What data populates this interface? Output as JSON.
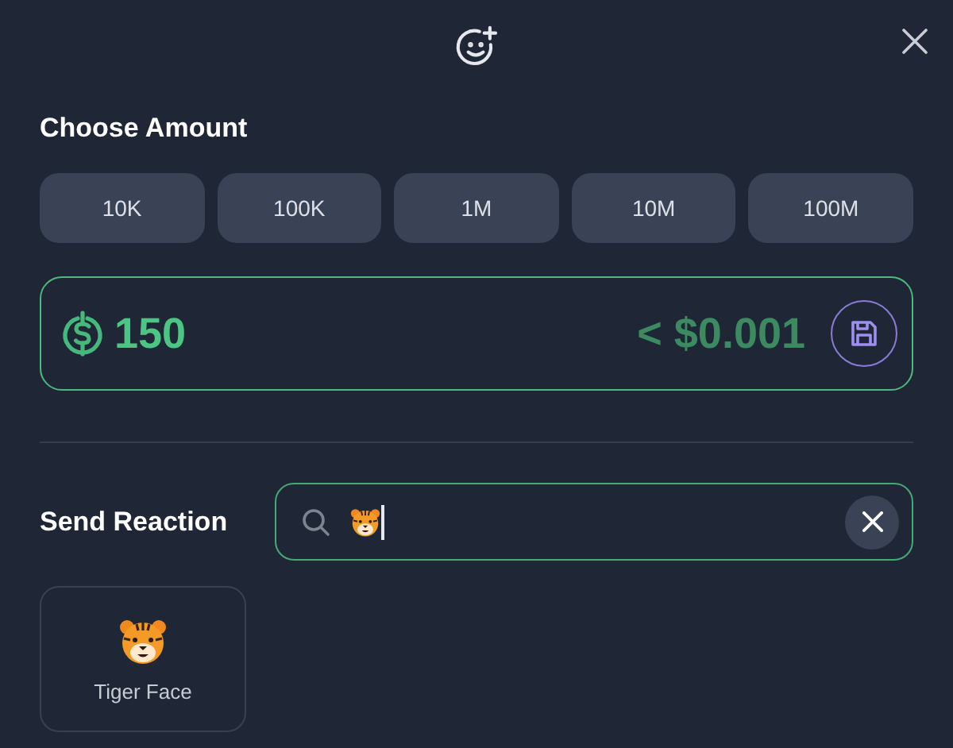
{
  "heading": "Choose Amount",
  "amounts": [
    "10K",
    "100K",
    "1M",
    "10M",
    "100M"
  ],
  "amount_field": {
    "value": "150",
    "converted": "< $0.001"
  },
  "reaction": {
    "label": "Send Reaction"
  },
  "results": [
    {
      "label": "Tiger Face"
    }
  ]
}
